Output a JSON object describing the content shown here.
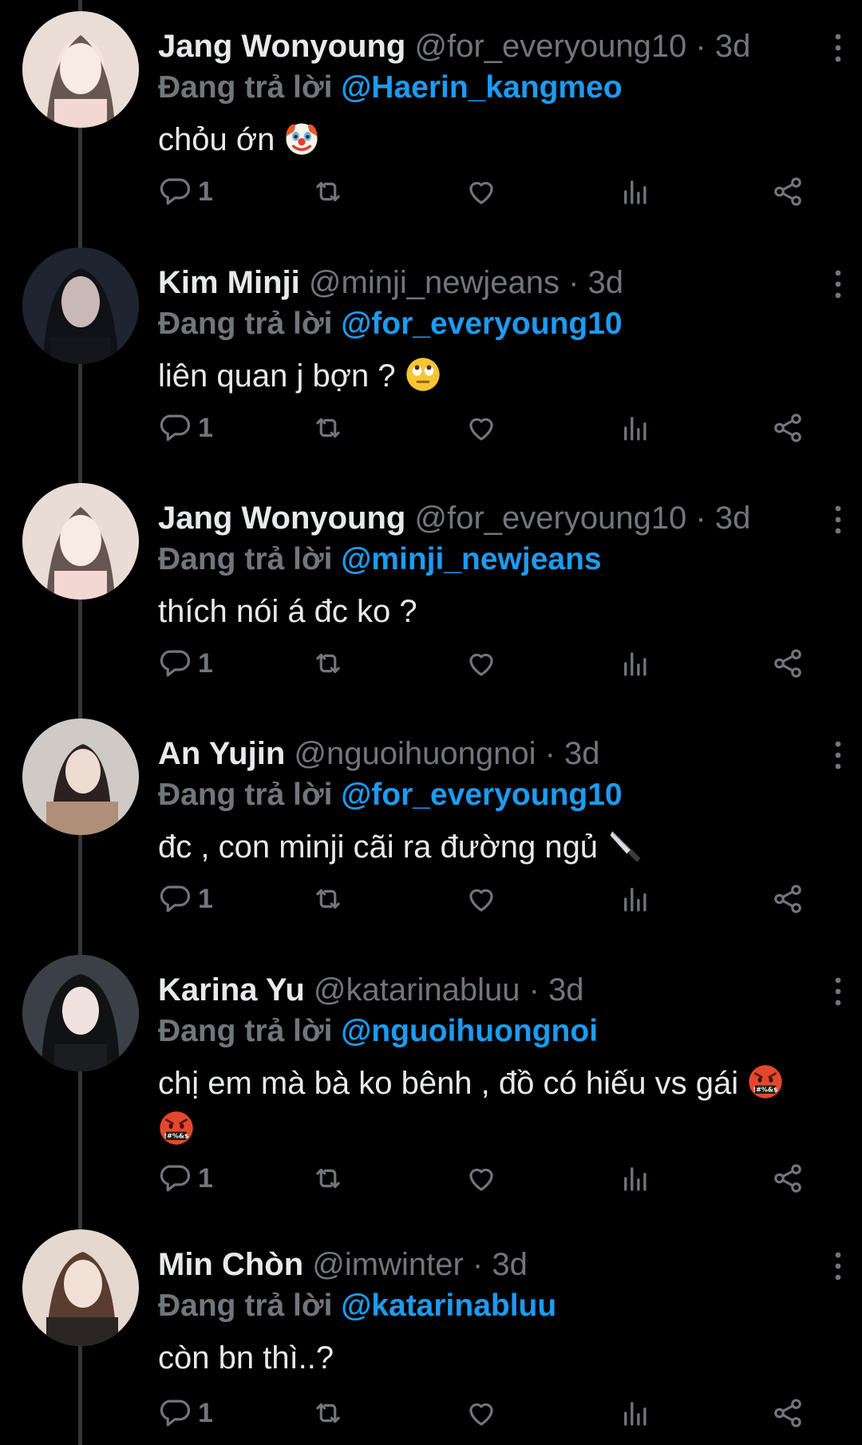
{
  "reply_prefix": "Đang trả lời",
  "tweets": [
    {
      "name": "Jang Wonyoung",
      "handle": "@for_everyoung10",
      "time": "3d",
      "reply_to": "@Haerin_kangmeo",
      "text": "chỏu ớn",
      "emoji": "clown-face",
      "reply_count": "1"
    },
    {
      "name": "Kim Minji",
      "handle": "@minji_newjeans",
      "time": "3d",
      "reply_to": "@for_everyoung10",
      "text": "liên quan j bợn ?",
      "emoji": "rolling-eyes-face",
      "reply_count": "1"
    },
    {
      "name": "Jang Wonyoung",
      "handle": "@for_everyoung10",
      "time": "3d",
      "reply_to": "@minji_newjeans",
      "text": "thích nói á đc ko ?",
      "emoji": "",
      "reply_count": "1"
    },
    {
      "name": "An Yujin",
      "handle": "@nguoihuongnoi",
      "time": "3d",
      "reply_to": "@for_everyoung10",
      "text": "đc , con minji cãi ra đường ngủ",
      "emoji": "knife",
      "reply_count": "1"
    },
    {
      "name": "Karina Yu",
      "handle": "@katarinabluu",
      "time": "3d",
      "reply_to": "@nguoihuongnoi",
      "text": "chị em mà bà ko bênh , đồ có hiếu vs gái",
      "emoji": "cursing-face",
      "reply_count": "1"
    },
    {
      "name": "Min Chòn",
      "handle": "@imwinter",
      "time": "3d",
      "reply_to": "@katarinabluu",
      "text": "còn bn thì..?",
      "emoji": "",
      "reply_count": "1"
    }
  ],
  "icons": {
    "reply": "reply-icon",
    "retweet": "retweet-icon",
    "like": "heart-icon",
    "views": "views-icon",
    "share": "share-icon",
    "more": "more-icon"
  },
  "colors": {
    "background": "#000000",
    "text": "#e7e9ea",
    "muted": "#71767b",
    "link": "#1d9bf0"
  }
}
